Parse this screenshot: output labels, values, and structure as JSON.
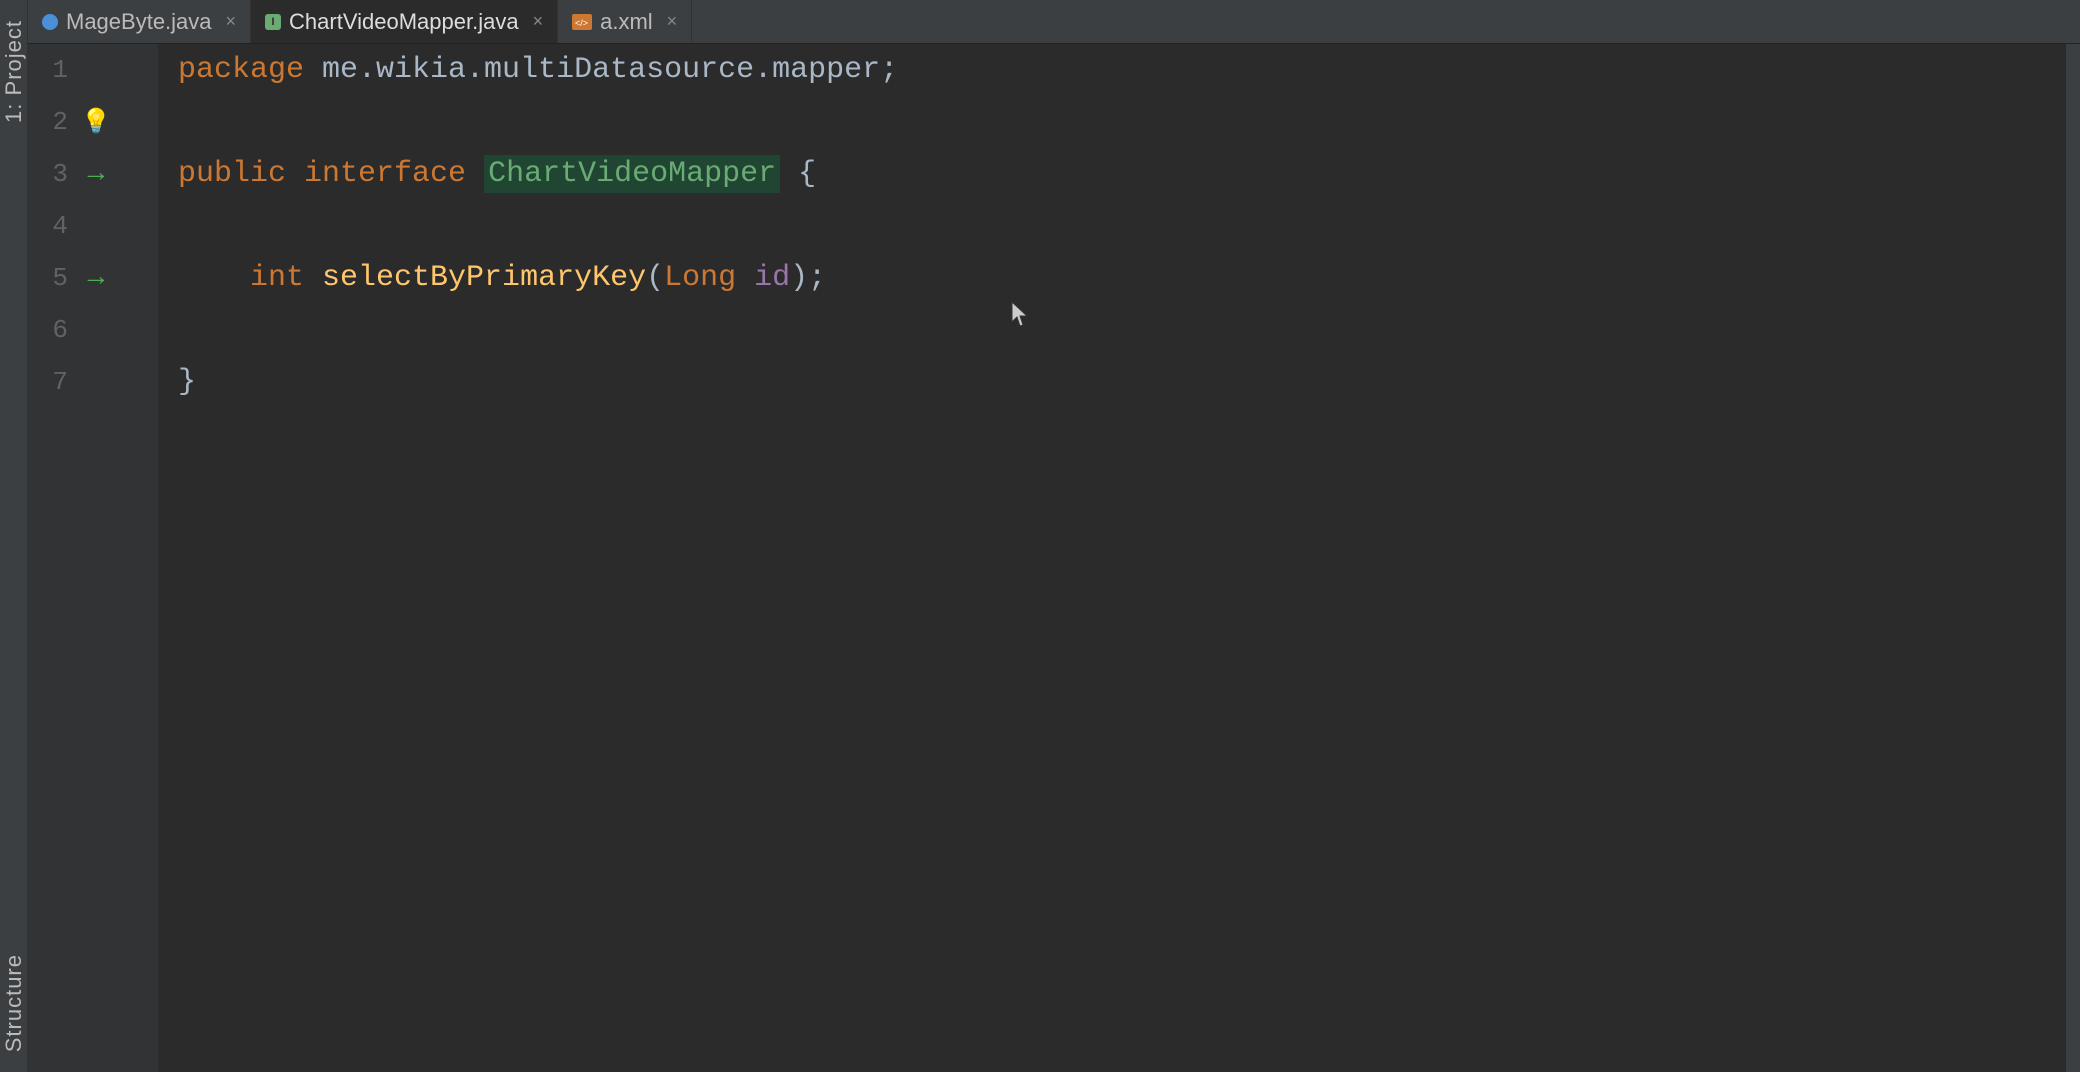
{
  "sidebar": {
    "project_label": "1: Project",
    "structure_label": "Structure"
  },
  "tabs": [
    {
      "id": "tab-magebyte",
      "filename": "MageByte.java",
      "icon_type": "blue-circle",
      "active": false
    },
    {
      "id": "tab-chartmapper",
      "filename": "ChartVideoMapper.java",
      "icon_type": "green-rect",
      "active": true
    },
    {
      "id": "tab-xml",
      "filename": "a.xml",
      "icon_type": "xml",
      "active": false
    }
  ],
  "code": {
    "lines": [
      {
        "number": 1,
        "arrow": false,
        "bulb": false,
        "content": "package me.wikia.multiDatasource.mapper;"
      },
      {
        "number": 2,
        "arrow": false,
        "bulb": true,
        "content": ""
      },
      {
        "number": 3,
        "arrow": true,
        "bulb": false,
        "content": "public interface ChartVideoMapper {"
      },
      {
        "number": 4,
        "arrow": false,
        "bulb": false,
        "content": ""
      },
      {
        "number": 5,
        "arrow": true,
        "bulb": false,
        "content": "    int selectByPrimaryKey(Long id);"
      },
      {
        "number": 6,
        "arrow": false,
        "bulb": false,
        "content": ""
      },
      {
        "number": 7,
        "arrow": false,
        "bulb": false,
        "content": "}"
      }
    ]
  },
  "colors": {
    "bg": "#2b2b2b",
    "gutter_bg": "#313335",
    "tab_bar_bg": "#3c3f41",
    "active_tab_bg": "#2b2b2b",
    "keyword_orange": "#cc7832",
    "keyword_green": "#6aab73",
    "interface_name_bg": "#214533",
    "method_yellow": "#ffc66d",
    "param_purple": "#9876aa",
    "plain_text": "#a9b7c6",
    "line_number": "#606366",
    "arrow_green": "#4caf50",
    "bulb_yellow": "#f0c040"
  }
}
